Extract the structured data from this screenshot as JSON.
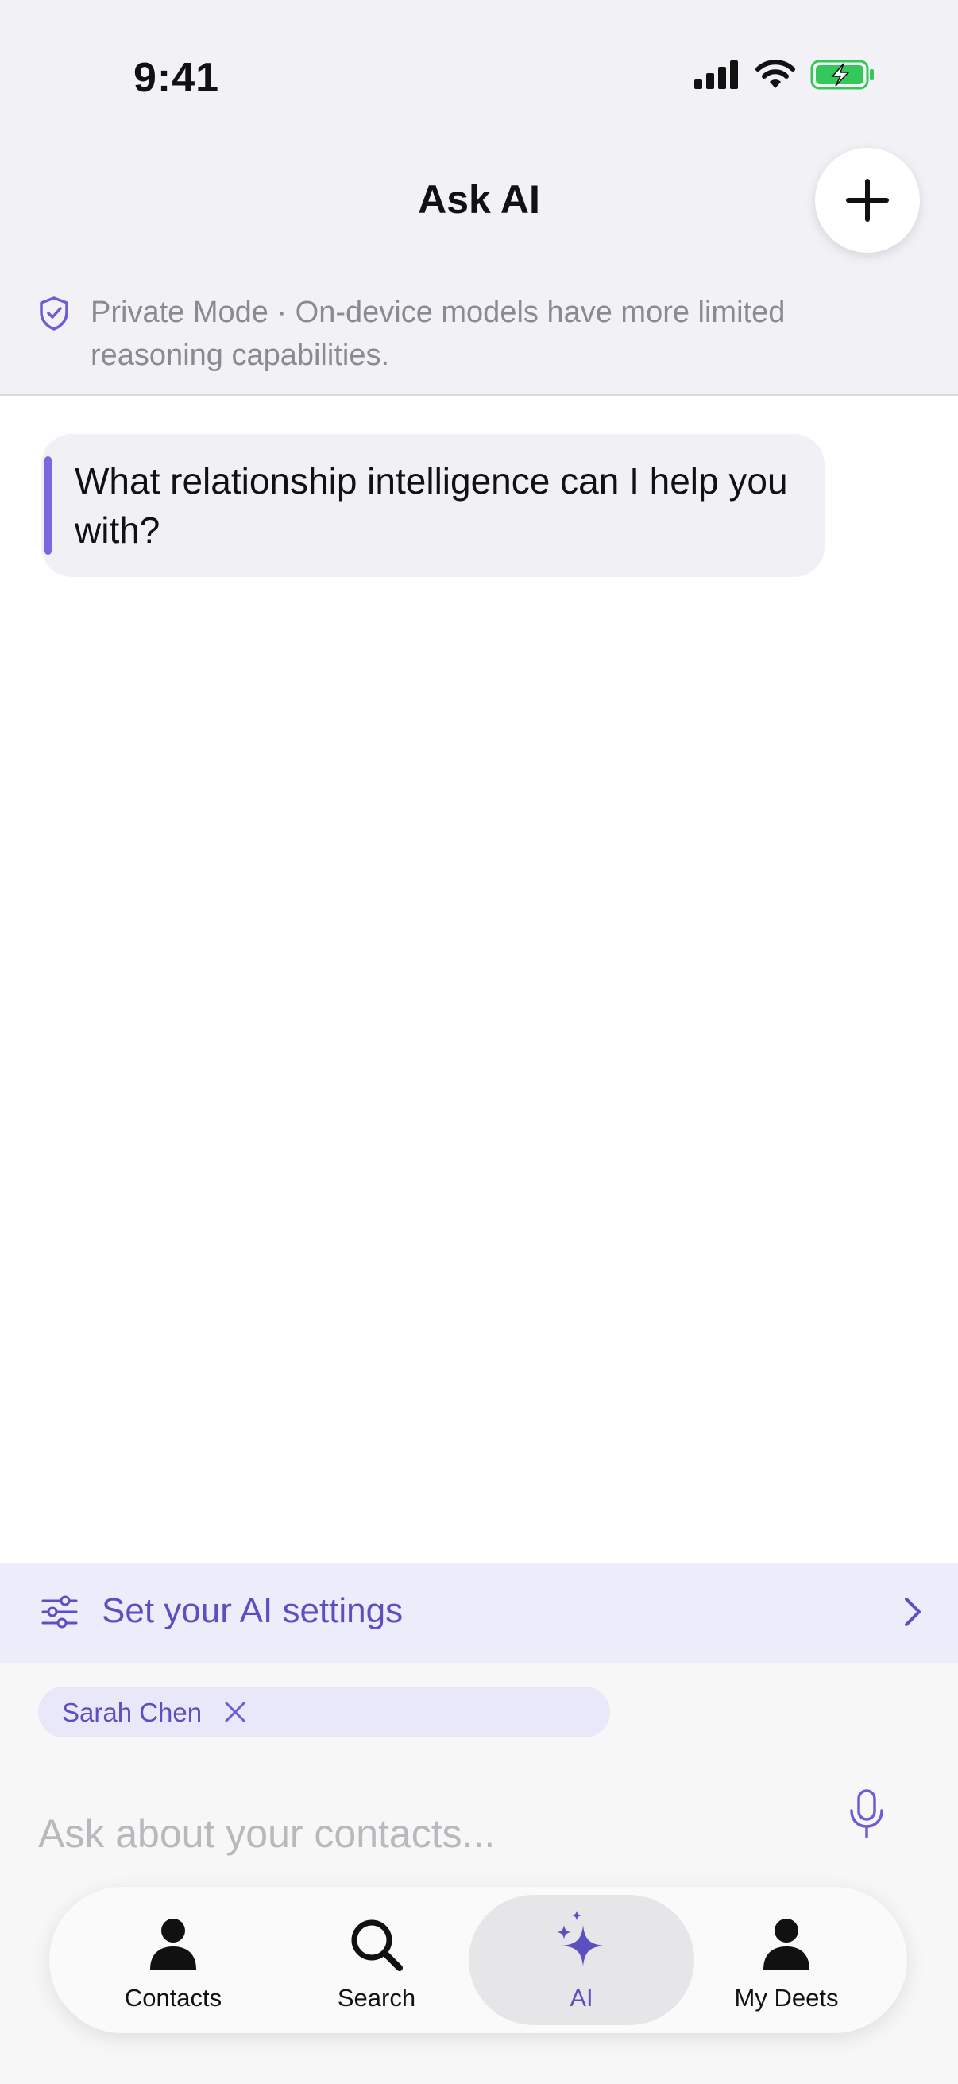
{
  "status_bar": {
    "time": "9:41"
  },
  "header": {
    "title": "Ask AI",
    "new_chat_icon": "plus-icon"
  },
  "private_mode": {
    "text": "Private Mode · On-device models have more limited reasoning capabilities.",
    "icon": "shield-check-icon"
  },
  "messages": [
    {
      "role": "assistant",
      "text": "What relationship intelligence can I help you with?"
    }
  ],
  "settings_banner": {
    "label": "Set your AI settings",
    "icon": "sliders-icon"
  },
  "context_chip": {
    "label": "Sarah Chen"
  },
  "composer": {
    "placeholder": "Ask about your contacts...",
    "value": ""
  },
  "tabs": [
    {
      "label": "Contacts",
      "icon": "person-icon",
      "active": false
    },
    {
      "label": "Search",
      "icon": "magnifier-icon",
      "active": false
    },
    {
      "label": "AI",
      "icon": "sparkle-icon",
      "active": true
    },
    {
      "label": "My Deets",
      "icon": "person-icon",
      "active": false
    }
  ],
  "colors": {
    "accent": "#5c4fc2",
    "accent_light": "#edecfb",
    "battery": "#34c759"
  }
}
